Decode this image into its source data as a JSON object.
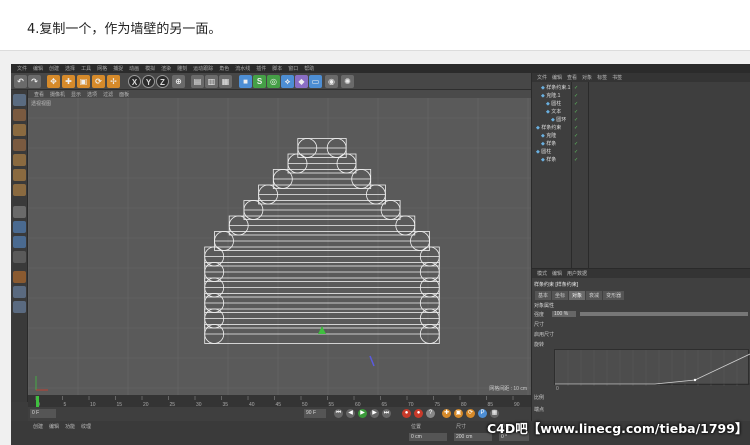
{
  "caption": "4.复制一个，作为墙壁的另一面。",
  "app": {
    "menus": [
      "文件",
      "编辑",
      "创建",
      "选择",
      "工具",
      "网格",
      "捕捉",
      "动画",
      "模拟",
      "渲染",
      "雕刻",
      "运动跟踪",
      "角色",
      "流水线",
      "插件",
      "脚本",
      "窗口",
      "帮助"
    ],
    "toolbar": {
      "x_label": "X",
      "y_label": "Y",
      "z_label": "Z"
    }
  },
  "viewport": {
    "menus": [
      "查看",
      "摄像机",
      "显示",
      "选项",
      "过滤",
      "面板"
    ],
    "label": "透视视图",
    "grid_distance": "网格间距 : 10 cm"
  },
  "timeline": {
    "start_frame": "0 F",
    "end_frame": "90 F",
    "ticks": [
      "0",
      "5",
      "10",
      "15",
      "20",
      "25",
      "30",
      "35",
      "40",
      "45",
      "50",
      "55",
      "60",
      "65",
      "70",
      "75",
      "80",
      "85",
      "90"
    ],
    "current_frame": "0 F"
  },
  "bottom": {
    "menus": [
      "创建",
      "编辑",
      "功能",
      "纹理"
    ],
    "position_label": "位置",
    "size_label": "尺寸",
    "rotation_label": "旋转",
    "pos_value": "0 cm",
    "size_value": "200 cm",
    "rot_value": "0 °"
  },
  "object_manager": {
    "menus": [
      "文件",
      "编辑",
      "查看",
      "对象",
      "标签",
      "书签"
    ],
    "rows": [
      {
        "name": "样条约束.1",
        "indent": 1
      },
      {
        "name": "克隆.1",
        "indent": 1
      },
      {
        "name": "圆柱",
        "indent": 2
      },
      {
        "name": "文本",
        "indent": 2
      },
      {
        "name": "圆环",
        "indent": 3
      },
      {
        "name": "样条约束",
        "indent": 0
      },
      {
        "name": "克隆",
        "indent": 1
      },
      {
        "name": "样条",
        "indent": 1
      },
      {
        "name": "圆柱",
        "indent": 0
      },
      {
        "name": "样条",
        "indent": 1
      }
    ]
  },
  "attribute_manager": {
    "menus": [
      "模式",
      "编辑",
      "用户数据"
    ],
    "object_title": "样条约束 [样条约束]",
    "tabs": [
      "基本",
      "坐标",
      "对象",
      "衰减",
      "变形器"
    ],
    "active_tab": 2,
    "section": "对象属性",
    "fields": [
      {
        "label": "强度",
        "value": "100 %"
      },
      {
        "label": "尺寸",
        "value": ""
      },
      {
        "label": "启用尺寸",
        "value": ""
      },
      {
        "label": "旋转",
        "value": ""
      }
    ],
    "zero_point": "0",
    "scale_label": "比例",
    "end_label": "端点"
  },
  "watermark": "C4D吧【www.linecg.com/tieba/1799】",
  "colors": {
    "bg": "#3c3c3c",
    "viewport": "#5a5a5a",
    "wire": "#f2f2f2",
    "axis_x": "#d83a2a",
    "axis_y": "#3fbf3f",
    "axis_z": "#3a3ad8",
    "accent": "#d68a2a"
  }
}
